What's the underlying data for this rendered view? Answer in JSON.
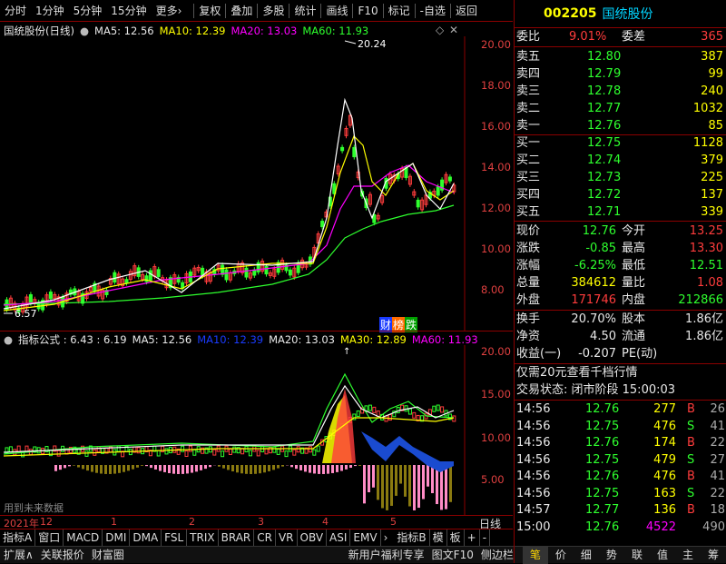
{
  "toolbar": {
    "items": [
      "分时",
      "1分钟",
      "5分钟",
      "15分钟",
      "更多",
      "复权",
      "叠加",
      "多股",
      "统计",
      "画线",
      "F10",
      "标记",
      "-自选",
      "返回"
    ],
    "more_arrow": "›"
  },
  "main_chart": {
    "title": "国统股份(日线)",
    "ma5": "MA5: 12.56",
    "ma10": "MA10: 12.39",
    "ma20": "MA20: 13.03",
    "ma60": "MA60: 11.93",
    "high_label": "20.24",
    "low_label": "6.57",
    "y_ticks": [
      "20.00",
      "18.00",
      "16.00",
      "14.00",
      "12.00",
      "10.00",
      "8.00"
    ],
    "badges": [
      "财",
      "榜",
      "跌"
    ]
  },
  "indicator": {
    "title": "指标公式 : 6.43 : 6.19",
    "ma5": "MA5: 12.56",
    "ma10": "MA10: 12.39",
    "ma20": "MA20: 13.03",
    "ma30": "MA30: 12.89",
    "ma60": "MA60: 11.93",
    "y_ticks": [
      "20.00",
      "15.00",
      "10.00",
      "5.00"
    ],
    "note": "用到未来数据"
  },
  "date_axis": {
    "year_label": "2021年",
    "month_12": "12",
    "months": [
      "1",
      "2",
      "3",
      "4",
      "5"
    ]
  },
  "bottom_tabs": [
    "指标A",
    "窗口",
    "MACD",
    "DMI",
    "DMA",
    "FSL",
    "TRIX",
    "BRAR",
    "CR",
    "VR",
    "OBV",
    "ASI",
    "EMV"
  ],
  "bottom_tabs_right": [
    "指标B",
    "模",
    "板",
    "+",
    "-"
  ],
  "period_label": "日线",
  "bottom_bar": {
    "left": [
      "扩展∧",
      "关联报价",
      "财富圈"
    ],
    "promo": "新用户福利专享",
    "right_mid": [
      "图文F10",
      "侧边栏"
    ],
    "right_tabs": [
      "笔",
      "价",
      "细",
      "势",
      "联",
      "值",
      "主",
      "筹"
    ]
  },
  "stock": {
    "code": "002205",
    "name": "国统股份"
  },
  "order_book": {
    "weibi_label": "委比",
    "weibi_value": "9.01%",
    "weicha_label": "委差",
    "weicha_value": "365",
    "asks": [
      {
        "label": "卖五",
        "price": "12.80",
        "vol": "387"
      },
      {
        "label": "卖四",
        "price": "12.79",
        "vol": "99"
      },
      {
        "label": "卖三",
        "price": "12.78",
        "vol": "240"
      },
      {
        "label": "卖二",
        "price": "12.77",
        "vol": "1032"
      },
      {
        "label": "卖一",
        "price": "12.76",
        "vol": "85"
      }
    ],
    "bids": [
      {
        "label": "买一",
        "price": "12.75",
        "vol": "1128"
      },
      {
        "label": "买二",
        "price": "12.74",
        "vol": "379"
      },
      {
        "label": "买三",
        "price": "12.73",
        "vol": "225"
      },
      {
        "label": "买四",
        "price": "12.72",
        "vol": "137"
      },
      {
        "label": "买五",
        "price": "12.71",
        "vol": "339"
      }
    ]
  },
  "quote": [
    {
      "l1": "现价",
      "v1": "12.76",
      "l2": "今开",
      "v2": "13.25"
    },
    {
      "l1": "涨跌",
      "v1": "-0.85",
      "l2": "最高",
      "v2": "13.30"
    },
    {
      "l1": "涨幅",
      "v1": "-6.25%",
      "l2": "最低",
      "v2": "12.51"
    },
    {
      "l1": "总量",
      "v1": "384612",
      "l2": "量比",
      "v2": "1.08"
    },
    {
      "l1": "外盘",
      "v1": "171746",
      "l2": "内盘",
      "v2": "212866"
    }
  ],
  "stats": [
    {
      "l1": "换手",
      "v1": "20.70%",
      "l2": "股本",
      "v2": "1.86亿"
    },
    {
      "l1": "净资",
      "v1": "4.50",
      "l2": "流通",
      "v2": "1.86亿"
    },
    {
      "l1": "收益(一)",
      "v1": "-0.207",
      "l2": "PE(动)",
      "v2": ""
    }
  ],
  "promo_line": "仅需20元查看千档行情",
  "trade_status": "交易状态: 闭市阶段 15:00:03",
  "ticks": [
    {
      "t": "14:56",
      "p": "12.76",
      "v": "277",
      "s": "B",
      "n": "26"
    },
    {
      "t": "14:56",
      "p": "12.75",
      "v": "476",
      "s": "S",
      "n": "41"
    },
    {
      "t": "14:56",
      "p": "12.76",
      "v": "174",
      "s": "B",
      "n": "22"
    },
    {
      "t": "14:56",
      "p": "12.75",
      "v": "479",
      "s": "S",
      "n": "27"
    },
    {
      "t": "14:56",
      "p": "12.76",
      "v": "476",
      "s": "B",
      "n": "41"
    },
    {
      "t": "14:56",
      "p": "12.75",
      "v": "163",
      "s": "S",
      "n": "22"
    },
    {
      "t": "14:57",
      "p": "12.77",
      "v": "136",
      "s": "B",
      "n": "18"
    },
    {
      "t": "15:00",
      "p": "12.76",
      "v": "4522",
      "s": "",
      "n": "490"
    }
  ]
}
